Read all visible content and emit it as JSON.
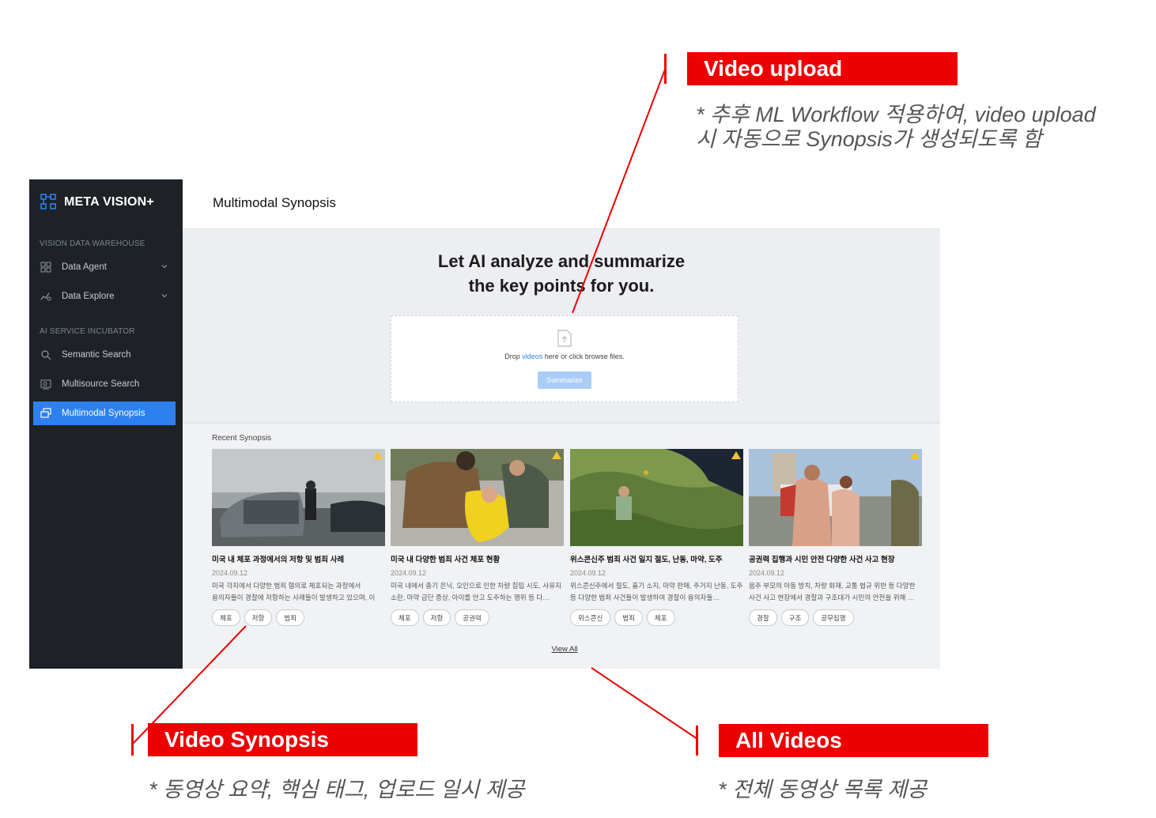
{
  "app": {
    "logo_text": "META VISION+",
    "sections": [
      {
        "label": "VISION DATA WAREHOUSE"
      },
      {
        "label": "AI SERVICE INCUBATOR"
      }
    ],
    "nav": [
      {
        "label": "Data Agent",
        "icon": "grid-icon"
      },
      {
        "label": "Data Explore",
        "icon": "chart-icon"
      },
      {
        "label": "Semantic Search",
        "icon": "search-icon"
      },
      {
        "label": "Multisource Search",
        "icon": "image-search-icon"
      },
      {
        "label": "Multimodal Synopsis",
        "icon": "layers-icon",
        "active": true
      }
    ],
    "page_title": "Multimodal Synopsis",
    "hero": {
      "line1": "Let AI analyze and summarize",
      "line2": "the key points for you."
    },
    "dropzone": {
      "text_before": "Drop ",
      "link": "videos",
      "text_after": " here or click browse files.",
      "button": "Summarize"
    },
    "recent_label": "Recent Synopsis",
    "cards": [
      {
        "title": "미국 내 체포 과정에서의 저항 및 범죄 사례",
        "date": "2024.09.12",
        "desc": "미국 각지에서 다양한 범죄 혐의로 체포되는 과정에서 용의자들이 경찰에 저항하는 사례들이 발생하고 있으며, 이 과…",
        "tags": [
          "체포",
          "저항",
          "범죄"
        ]
      },
      {
        "title": "미국 내 다양한 범죄 사건 체포 현황",
        "date": "2024.09.12",
        "desc": "미국 내에서 총기 은닉, 오인으로 인한 차량 침입 시도, 사유지 소란, 마약 금단 증상, 아이를 안고 도주하는 행위 등 다…",
        "tags": [
          "체포",
          "저항",
          "공권력"
        ]
      },
      {
        "title": "위스콘신주 범죄 사건 일지 절도, 난동, 마약, 도주",
        "date": "2024.09.12",
        "desc": "위스콘신주에서 절도, 흉기 소지, 마약 판매, 주거지 난동, 도주 등 다양한 범죄 사건들이 발생하여 경찰이 용의자들…",
        "tags": [
          "위스콘신",
          "범죄",
          "체포"
        ]
      },
      {
        "title": "공권력 집행과 시민 안전 다양한 사건 사고 현장",
        "date": "2024.09.12",
        "desc": "음주 부모의 아동 방치, 차량 화재, 교통 법규 위반 등 다양한 사건 사고 현장에서 경찰과 구조대가 시민의 안전을 위해 …",
        "tags": [
          "경찰",
          "구조",
          "공무집행"
        ]
      }
    ],
    "view_all": "View All"
  },
  "annotations": {
    "upload": {
      "title": "Video upload",
      "note1": "* 추후 ML Workflow 적용하여, video upload",
      "note2": "시 자동으로 Synopsis가 생성되도록 함"
    },
    "synopsis": {
      "title": "Video Synopsis",
      "note": "* 동영상 요약,  핵심 태그, 업로드 일시  제공"
    },
    "all_videos": {
      "title": "All Videos",
      "note": "* 전체 동영상 목록 제공"
    },
    "accent_color": "#ee0000"
  }
}
